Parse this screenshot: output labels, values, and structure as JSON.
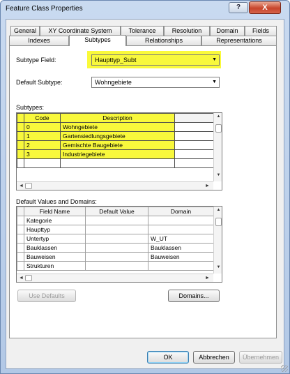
{
  "window": {
    "title": "Feature Class Properties",
    "help_glyph": "?",
    "close_glyph": "X"
  },
  "tabs": {
    "row1": [
      "General",
      "XY Coordinate System",
      "Tolerance",
      "Resolution",
      "Domain",
      "Fields"
    ],
    "row2": [
      "Indexes",
      "Subtypes",
      "Relationships",
      "Representations"
    ],
    "active": "Subtypes"
  },
  "subtype_field": {
    "label": "Subtype Field:",
    "value": "Haupttyp_Subt"
  },
  "default_subtype": {
    "label": "Default Subtype:",
    "value": "Wohngebiete"
  },
  "subtypes": {
    "label": "Subtypes:",
    "columns": [
      "Code",
      "Description"
    ],
    "rows": [
      {
        "code": "0",
        "description": "Wohngebiete"
      },
      {
        "code": "1",
        "description": "Gartensiedlungsgebiete"
      },
      {
        "code": "2",
        "description": "Gemischte Baugebiete"
      },
      {
        "code": "3",
        "description": "Industriegebiete"
      }
    ]
  },
  "defaults": {
    "label": "Default Values and Domains:",
    "columns": [
      "Field Name",
      "Default Value",
      "Domain"
    ],
    "rows": [
      {
        "field": "Kategorie",
        "default": "",
        "domain": ""
      },
      {
        "field": "Haupttyp",
        "default": "",
        "domain": ""
      },
      {
        "field": "Untertyp",
        "default": "",
        "domain": "W_UT"
      },
      {
        "field": "Bauklassen",
        "default": "",
        "domain": "Bauklassen"
      },
      {
        "field": "Bauweisen",
        "default": "",
        "domain": "Bauweisen"
      },
      {
        "field": "Strukturen",
        "default": "",
        "domain": ""
      }
    ]
  },
  "buttons": {
    "use_defaults": "Use Defaults",
    "domains": "Domains...",
    "ok": "OK",
    "cancel": "Abbrechen",
    "apply": "Übernehmen"
  },
  "colors": {
    "highlight": "#f8f83c",
    "title_bar": "#c9daf0",
    "close_button": "#c7452b"
  }
}
